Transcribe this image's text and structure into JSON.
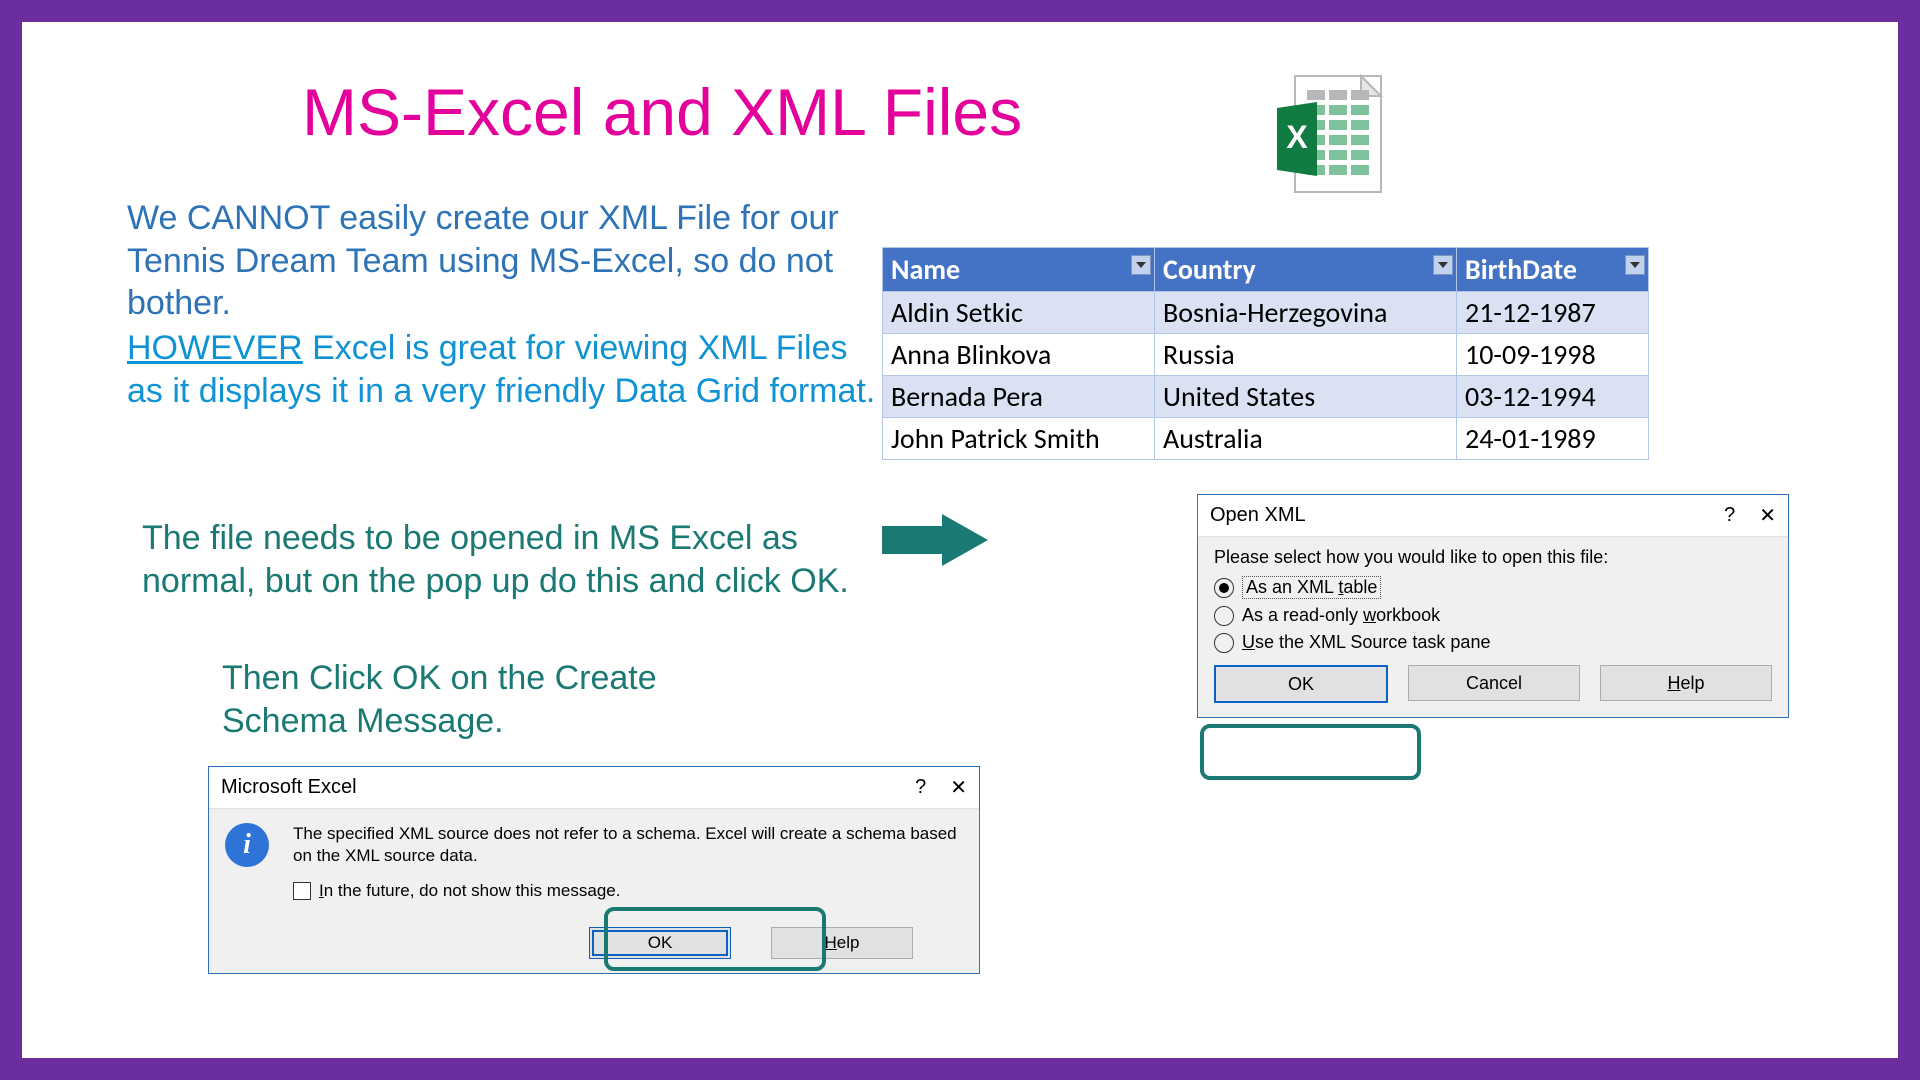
{
  "title": "MS-Excel and XML Files",
  "para1": "We CANNOT easily create our XML File for our Tennis Dream Team using MS-Excel, so do not bother.",
  "para2_however": "HOWEVER",
  "para2_rest": " Excel is great for viewing XML Files as it displays it in a very friendly Data Grid format.",
  "para3": "The file needs to be opened in MS Excel as normal, but on the pop up do this and click OK.",
  "para4": "Then Click OK on the Create Schema Message.",
  "grid": {
    "headers": [
      "Name",
      "Country",
      "BirthDate"
    ],
    "rows": [
      [
        "Aldin Setkic",
        "Bosnia-Herzegovina",
        "21-12-1987"
      ],
      [
        "Anna Blinkova",
        "Russia",
        "10-09-1998"
      ],
      [
        "Bernada Pera",
        "United States",
        "03-12-1994"
      ],
      [
        "John Patrick Smith",
        "Australia",
        "24-01-1989"
      ]
    ]
  },
  "openxml": {
    "title": "Open XML",
    "prompt": "Please select how you would like to open this file:",
    "opt1_pre": "As an XML ",
    "opt1_u": "t",
    "opt1_post": "able",
    "opt2_pre": "As a read-only ",
    "opt2_u": "w",
    "opt2_post": "orkbook",
    "opt3_u": "U",
    "opt3_post": "se the XML Source task pane",
    "ok": "OK",
    "cancel": "Cancel",
    "help_u": "H",
    "help_post": "elp"
  },
  "excelmsg": {
    "title": "Microsoft Excel",
    "msg": "The specified XML source does not refer to a schema. Excel will create a schema based on the XML source data.",
    "chk_u": "I",
    "chk_post": "n the future, do not show this message.",
    "ok": "OK",
    "help_u": "H",
    "help_post": "elp"
  }
}
